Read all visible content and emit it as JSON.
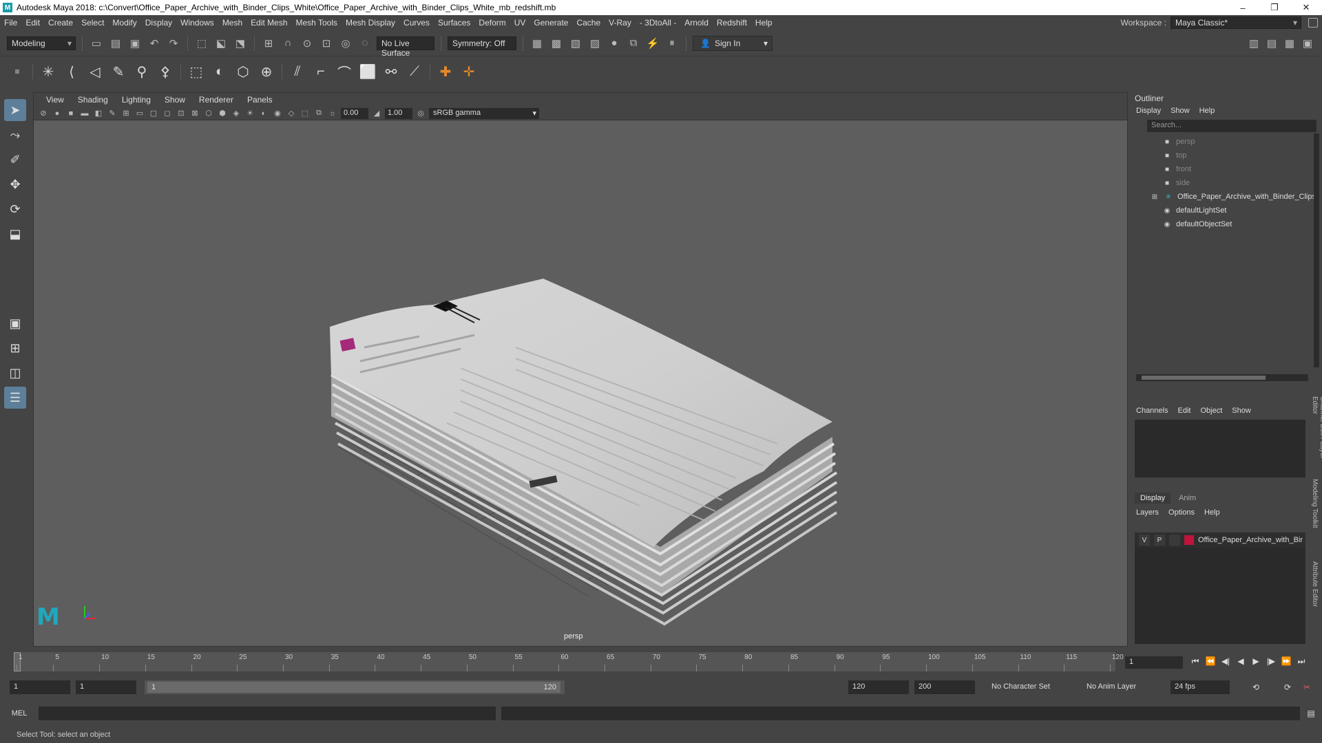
{
  "window": {
    "title": "Autodesk Maya 2018: c:\\Convert\\Office_Paper_Archive_with_Binder_Clips_White\\Office_Paper_Archive_with_Binder_Clips_White_mb_redshift.mb",
    "app_icon": "M",
    "controls": {
      "minimize": "–",
      "maximize": "❐",
      "close": "✕"
    }
  },
  "menubar": {
    "items": [
      "File",
      "Edit",
      "Create",
      "Select",
      "Modify",
      "Display",
      "Windows",
      "Mesh",
      "Edit Mesh",
      "Mesh Tools",
      "Mesh Display",
      "Curves",
      "Surfaces",
      "Deform",
      "UV",
      "Generate",
      "Cache",
      "V-Ray",
      "- 3DtoAll -",
      "Arnold",
      "Redshift",
      "Help"
    ],
    "workspace_label": "Workspace :",
    "workspace_value": "Maya Classic*"
  },
  "statusline": {
    "mode": "Modeling",
    "live_surface": "No Live Surface",
    "symmetry": "Symmetry: Off",
    "sign_in": "Sign In"
  },
  "viewport": {
    "menu": [
      "View",
      "Shading",
      "Lighting",
      "Show",
      "Renderer",
      "Panels"
    ],
    "exposure": "0.00",
    "gamma_value": "1.00",
    "color_space": "sRGB gamma",
    "camera_label": "persp"
  },
  "outliner": {
    "title": "Outliner",
    "menu": [
      "Display",
      "Show",
      "Help"
    ],
    "search_placeholder": "Search...",
    "items": [
      {
        "label": "persp",
        "icon": "camera-icon",
        "dim": true
      },
      {
        "label": "top",
        "icon": "camera-icon",
        "dim": true
      },
      {
        "label": "front",
        "icon": "camera-icon",
        "dim": true
      },
      {
        "label": "side",
        "icon": "camera-icon",
        "dim": true
      },
      {
        "label": "Office_Paper_Archive_with_Binder_Clips",
        "icon": "transform-icon",
        "dim": false
      },
      {
        "label": "defaultLightSet",
        "icon": "set-icon",
        "dim": false
      },
      {
        "label": "defaultObjectSet",
        "icon": "set-icon",
        "dim": false
      }
    ]
  },
  "channelbox": {
    "menu": [
      "Channels",
      "Edit",
      "Object",
      "Show"
    ]
  },
  "layereditor": {
    "tabs": [
      "Display",
      "Anim"
    ],
    "menu": [
      "Layers",
      "Options",
      "Help"
    ],
    "layer": {
      "v": "V",
      "p": "P",
      "name": "Office_Paper_Archive_with_Bir",
      "color": "#c0143c"
    }
  },
  "side_tabs": [
    "Channel Box / Layer Editor",
    "Modeling Toolkit",
    "Attribute Editor"
  ],
  "timeline": {
    "ticks": [
      1,
      5,
      10,
      15,
      20,
      25,
      30,
      35,
      40,
      45,
      50,
      55,
      60,
      65,
      70,
      75,
      80,
      85,
      90,
      95,
      100,
      105,
      110,
      115,
      120
    ],
    "min": 1,
    "max": 120,
    "current": 1,
    "current_frame_field": "1"
  },
  "range": {
    "start": "1",
    "start_inner": "1",
    "slider_start": "1",
    "slider_end": "120",
    "end_inner": "120",
    "end": "200",
    "character_set": "No Character Set",
    "anim_layer": "No Anim Layer",
    "fps": "24 fps"
  },
  "commandline": {
    "lang": "MEL",
    "help": "Select Tool: select an object"
  },
  "colors": {
    "accent": "#20a8bd",
    "active_tool": "#5d7f99",
    "layer_color": "#c0143c"
  }
}
